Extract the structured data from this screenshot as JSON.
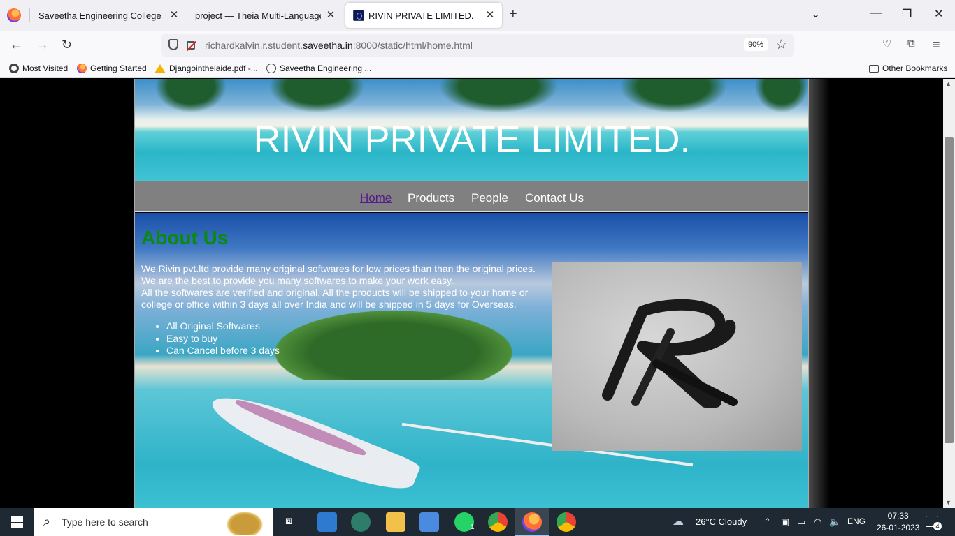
{
  "browser": {
    "tabs": [
      {
        "title": "Saveetha Engineering College"
      },
      {
        "title": "project — Theia Multi-Language Ex"
      },
      {
        "title": "RIVIN PRIVATE LIMITED."
      }
    ],
    "url_prefix": "richardkalvin.r.student.",
    "url_domain": "saveetha.in",
    "url_suffix": ":8000/static/html/home.html",
    "zoom": "90%",
    "bookmarks": [
      {
        "label": "Most Visited"
      },
      {
        "label": "Getting Started"
      },
      {
        "label": "Djangointheiaide.pdf -..."
      },
      {
        "label": "Saveetha Engineering ..."
      }
    ],
    "other_bookmarks": "Other Bookmarks"
  },
  "site": {
    "banner_title": "RIVIN PRIVATE LIMITED.",
    "menu": [
      {
        "label": "Home",
        "active": true
      },
      {
        "label": "Products"
      },
      {
        "label": "People"
      },
      {
        "label": "Contact Us"
      }
    ],
    "heading": "About Us",
    "paragraph_lines": [
      "We Rivin pvt.ltd provide many original softwares for low prices than than the original prices.",
      "We are the best to provide you many softwares to make your work easy.",
      "All the softwares are verified and original. All the products will be shipped to your home or college or office within 3 days all over India and will be shipped in 5 days for Overseas."
    ],
    "features": [
      "All Original Softwares",
      "Easy to buy",
      "Can Cancel before 3 days"
    ],
    "colors": {
      "heading": "#0b8a10",
      "menu_bg": "#808080",
      "active_link": "#551a8b"
    }
  },
  "taskbar": {
    "search_placeholder": "Type here to search",
    "weather": "26°C  Cloudy",
    "language": "ENG",
    "time": "07:33",
    "date": "26-01-2023",
    "whatsapp_badge": "1",
    "notifications": "4"
  }
}
